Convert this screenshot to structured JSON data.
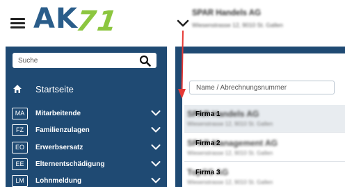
{
  "header": {
    "menu_icon": "hamburger-menu-icon",
    "logo": {
      "letters": "AK",
      "number": "71",
      "letters_color": "#2a5d8a",
      "number_color": "#8cc63f"
    },
    "company_switch_icon": "chevron-down-icon",
    "company_name": "SPAR Handels AG",
    "company_address": "Wiesenstrasse 12, 9010 St. Gallen"
  },
  "sidebar": {
    "background": "#1f4a73",
    "search_placeholder": "Suche",
    "search_icon": "search-icon",
    "home_label": "Startseite",
    "home_icon": "home-icon",
    "items": [
      {
        "code": "MA",
        "label": "Mitarbeitende"
      },
      {
        "code": "FZ",
        "label": "Familienzulagen"
      },
      {
        "code": "EO",
        "label": "Erwerbsersatz"
      },
      {
        "code": "EE",
        "label": "Elternentschädigung"
      },
      {
        "code": "LM",
        "label": "Lohnmeldung"
      }
    ]
  },
  "main": {
    "filter_placeholder": "Name / Abrechnungsnummer",
    "annotation_arrow_color": "#e53935",
    "companies": [
      {
        "label": "Firma 1",
        "name": "SPAR Handels AG",
        "address": "Wiesenstrasse 12, 9010 St. Gallen",
        "selected": true
      },
      {
        "label": "Firma 2",
        "name": "SPAR Management AG",
        "address": "Wiesenstrasse 12, 9010 St. Gallen",
        "selected": false
      },
      {
        "label": "Firma 3",
        "name": "TopCC AG",
        "address": "Wiesenstrasse 12, 9010 St. Gallen",
        "selected": false
      }
    ]
  }
}
